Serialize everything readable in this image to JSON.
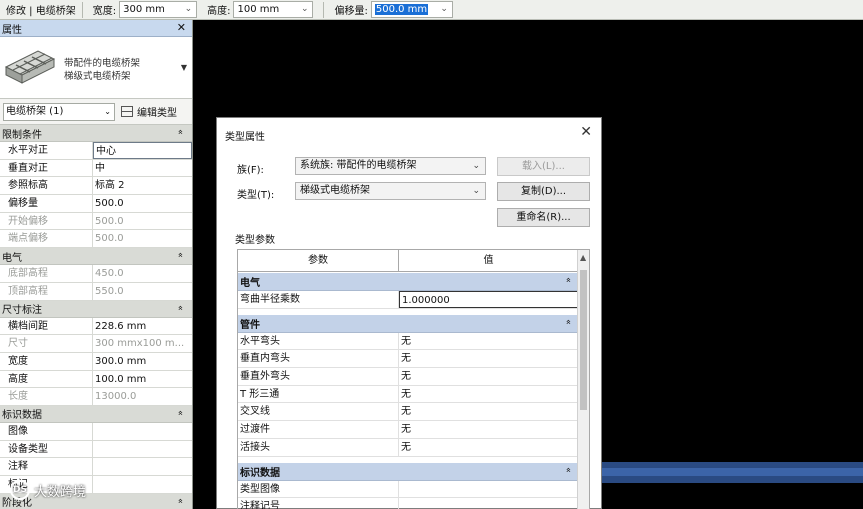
{
  "options_bar": {
    "mode": "修改 | 电缆桥架",
    "width_label": "宽度:",
    "width_value": "300 mm",
    "height_label": "高度:",
    "height_value": "100 mm",
    "offset_label": "偏移量:",
    "offset_value": "500.0 mm"
  },
  "properties": {
    "title": "属性",
    "type_line1": "带配件的电缆桥架",
    "type_line2": "梯级式电缆桥架",
    "instance_selector": "电缆桥架 (1)",
    "edit_type": "编辑类型",
    "groups": [
      {
        "name": "限制条件",
        "rows": [
          {
            "k": "水平对正",
            "v": "中心",
            "disabled": false
          },
          {
            "k": "垂直对正",
            "v": "中",
            "disabled": false
          },
          {
            "k": "参照标高",
            "v": "标高 2",
            "disabled": false
          },
          {
            "k": "偏移量",
            "v": "500.0",
            "disabled": false
          },
          {
            "k": "开始偏移",
            "v": "500.0",
            "disabled": true
          },
          {
            "k": "端点偏移",
            "v": "500.0",
            "disabled": true
          }
        ]
      },
      {
        "name": "电气",
        "rows": [
          {
            "k": "底部高程",
            "v": "450.0",
            "disabled": true
          },
          {
            "k": "顶部高程",
            "v": "550.0",
            "disabled": true
          }
        ]
      },
      {
        "name": "尺寸标注",
        "rows": [
          {
            "k": "横档间距",
            "v": "228.6 mm",
            "disabled": false
          },
          {
            "k": "尺寸",
            "v": "300 mmx100 m...",
            "disabled": true
          },
          {
            "k": "宽度",
            "v": "300.0 mm",
            "disabled": false
          },
          {
            "k": "高度",
            "v": "100.0 mm",
            "disabled": false
          },
          {
            "k": "长度",
            "v": "13000.0",
            "disabled": true
          }
        ]
      },
      {
        "name": "标识数据",
        "rows": [
          {
            "k": "图像",
            "v": "",
            "disabled": false
          },
          {
            "k": "设备类型",
            "v": "",
            "disabled": false
          },
          {
            "k": "注释",
            "v": "",
            "disabled": false
          },
          {
            "k": "标记",
            "v": "",
            "disabled": false
          }
        ]
      },
      {
        "name": "阶段化",
        "rows": []
      }
    ]
  },
  "dialog": {
    "title": "类型属性",
    "family_label": "族(F):",
    "family_value": "系统族: 带配件的电缆桥架",
    "type_label": "类型(T):",
    "type_value": "梯级式电缆桥架",
    "load_button": "载入(L)...",
    "duplicate_button": "复制(D)...",
    "rename_button": "重命名(R)...",
    "type_params_label": "类型参数",
    "col_param": "参数",
    "col_value": "值",
    "groups": [
      {
        "name": "电气",
        "rows": [
          {
            "k": "弯曲半径乘数",
            "v": "1.000000"
          }
        ]
      },
      {
        "name": "管件",
        "rows": [
          {
            "k": "水平弯头",
            "v": "无"
          },
          {
            "k": "垂直内弯头",
            "v": "无"
          },
          {
            "k": "垂直外弯头",
            "v": "无"
          },
          {
            "k": "T 形三通",
            "v": "无"
          },
          {
            "k": "交叉线",
            "v": "无"
          },
          {
            "k": "过渡件",
            "v": "无"
          },
          {
            "k": "活接头",
            "v": "无"
          }
        ]
      },
      {
        "name": "标识数据",
        "rows": [
          {
            "k": "类型图像",
            "v": ""
          },
          {
            "k": "注释记号",
            "v": ""
          }
        ]
      }
    ]
  },
  "watermark": {
    "logo": "DS",
    "text": "大数跨境"
  }
}
